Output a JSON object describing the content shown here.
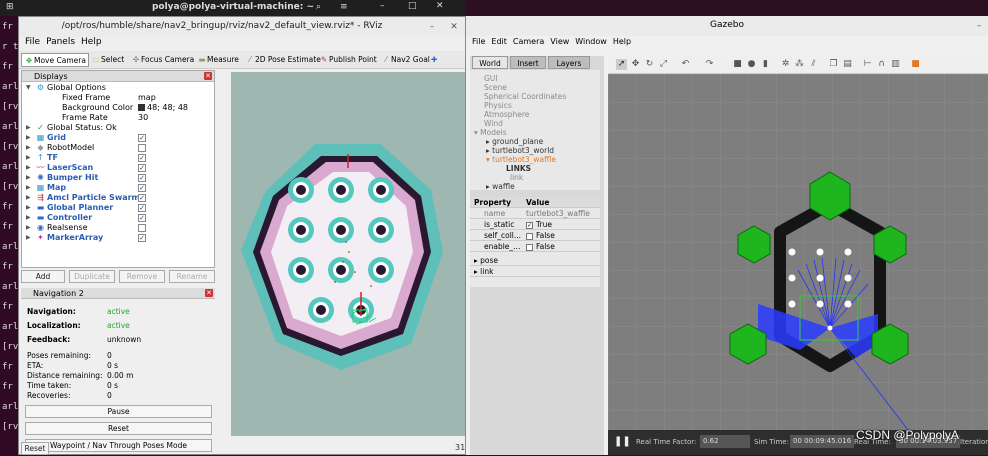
{
  "terminal": {
    "title": "polya@polya-virtual-machine: ~",
    "lines": [
      "fr",
      "r t",
      "fr",
      "arl",
      "[rv",
      "arl",
      "[rv",
      "arl",
      "[rv",
      "fr",
      "fr",
      "arl",
      "fr",
      "arl",
      "fr",
      "arl",
      "[rv",
      "fr",
      "fr",
      "arl",
      "[rv"
    ]
  },
  "rviz": {
    "title": "/opt/ros/humble/share/nav2_bringup/rviz/nav2_default_view.rviz* - RViz",
    "menu": [
      "File",
      "Panels",
      "Help"
    ],
    "tools": [
      "Move Camera",
      "Select",
      "Focus Camera",
      "Measure",
      "2D Pose Estimate",
      "Publish Point",
      "Nav2 Goal"
    ],
    "displays_title": "Displays",
    "global_options": "Global Options",
    "fixed_frame_label": "Fixed Frame",
    "fixed_frame_value": "map",
    "bg_color_label": "Background Color",
    "bg_color_value": "48; 48; 48",
    "frame_rate_label": "Frame Rate",
    "frame_rate_value": "30",
    "global_status": "Global Status: Ok",
    "displays": [
      {
        "name": "Grid",
        "checked": true,
        "blue": true
      },
      {
        "name": "RobotModel",
        "checked": false,
        "blue": false
      },
      {
        "name": "TF",
        "checked": true,
        "blue": true
      },
      {
        "name": "LaserScan",
        "checked": true,
        "blue": true
      },
      {
        "name": "Bumper Hit",
        "checked": true,
        "blue": true
      },
      {
        "name": "Map",
        "checked": true,
        "blue": true
      },
      {
        "name": "Amcl Particle Swarm",
        "checked": true,
        "blue": true
      },
      {
        "name": "Global Planner",
        "checked": true,
        "blue": true
      },
      {
        "name": "Controller",
        "checked": true,
        "blue": true
      },
      {
        "name": "Realsense",
        "checked": false,
        "blue": false
      },
      {
        "name": "MarkerArray",
        "checked": true,
        "blue": true
      }
    ],
    "buttons": [
      "Add",
      "Duplicate",
      "Remove",
      "Rename"
    ],
    "nav_title": "Navigation 2",
    "navigation_label": "Navigation:",
    "navigation_value": "active",
    "localization_label": "Localization:",
    "localization_value": "active",
    "feedback_label": "Feedback:",
    "feedback_value": "unknown",
    "stats": [
      {
        "label": "Poses remaining:",
        "value": "0"
      },
      {
        "label": "ETA:",
        "value": "0 s"
      },
      {
        "label": "Distance remaining:",
        "value": "0.00 m"
      },
      {
        "label": "Time taken:",
        "value": "0 s"
      },
      {
        "label": "Recoveries:",
        "value": "0"
      }
    ],
    "pause": "Pause",
    "reset": "Reset",
    "waypoint": "Waypoint / Nav Through Poses Mode",
    "bottom_reset": "Reset",
    "status_fps": "31"
  },
  "gazebo": {
    "title": "Gazebo",
    "menu": [
      "File",
      "Edit",
      "Camera",
      "View",
      "Window",
      "Help"
    ],
    "tabs": [
      "World",
      "Insert",
      "Layers"
    ],
    "tree": [
      "GUI",
      "Scene",
      "Spherical Coordinates",
      "Physics",
      "Atmosphere",
      "Wind",
      "Models",
      "ground_plane",
      "turtlebot3_world",
      "turtlebot3_waffle",
      "LINKS",
      "link",
      "waffle"
    ],
    "prop_h1": "Property",
    "prop_h2": "Value",
    "props": [
      {
        "k": "name",
        "v": "turtlebot3_waffle"
      },
      {
        "k": "is_static",
        "v": "True"
      },
      {
        "k": "self_coll...",
        "v": "False"
      },
      {
        "k": "enable_...",
        "v": "False"
      }
    ],
    "pose": "pose",
    "link": "link",
    "rtf_label": "Real Time Factor:",
    "rtf_value": "0.62",
    "sim_label": "Sim Time:",
    "sim_value": "00 00:09:45.016",
    "real_label": "Real Time:",
    "real_value": "00 00:14:03.957",
    "iter_label": "Iteration"
  },
  "watermark": "CSDN @PolypolyA"
}
